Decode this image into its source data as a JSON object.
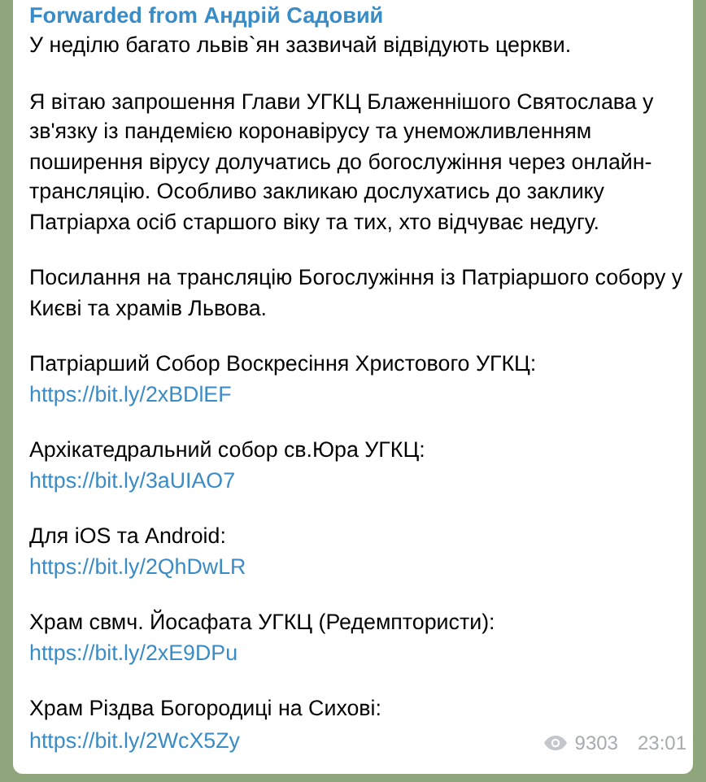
{
  "message": {
    "forwarded_from": "Forwarded from Андрій Садовий",
    "paragraphs": [
      "У неділю багато львів`ян зазвичай відвідують церкви.",
      "Я вітаю запрошення Глави УГКЦ Блаженнішого Святослава у зв'язку із пандемією коронавірусу та унеможливленням поширення вірусу долучатись до богослужіння через онлайн-трансляцію. Особливо закликаю дослухатись до заклику Патріарха осіб старшого віку та тих, хто відчуває недугу.",
      "Посилання на трансляцію Богослужіння із Патріаршого собору у Києві та храмів Львова."
    ],
    "links": [
      {
        "label": "Патріарший Собор Воскресіння Христового УГКЦ:",
        "url": "https://bit.ly/2xBDlEF"
      },
      {
        "label": "Архікатедральний собор св.Юра УГКЦ:",
        "url": "https://bit.ly/3aUIAO7"
      },
      {
        "label": "Для iOS та Android:",
        "url": "https://bit.ly/2QhDwLR"
      },
      {
        "label": "Храм свмч. Йосафата УГКЦ (Редемптористи):",
        "url": "https://bit.ly/2xE9DPu"
      },
      {
        "label": "Храм Різдва Богородиці на Сихові:",
        "url": "https://bit.ly/2WcX5Zy"
      }
    ],
    "views": "9303",
    "time": "23:01"
  }
}
